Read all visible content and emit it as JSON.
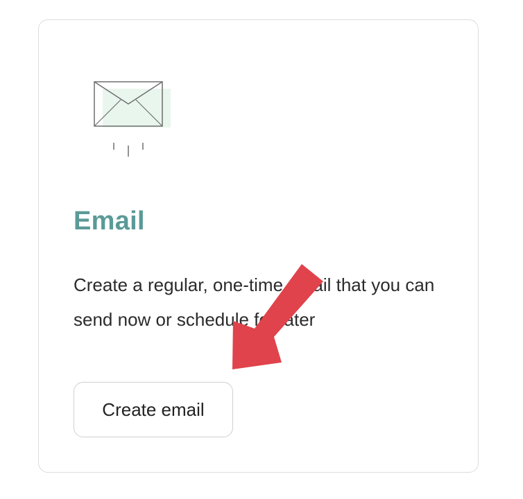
{
  "card": {
    "title": "Email",
    "description": "Create a regular, one-time email that you can send now or schedule for later",
    "button_label": "Create email"
  },
  "colors": {
    "title": "#5a9a97",
    "envelope_fill": "#e9f6ee",
    "annotation_arrow": "#e0434b"
  },
  "icons": {
    "card_icon": "envelope-icon",
    "annotation": "arrow-annotation"
  }
}
